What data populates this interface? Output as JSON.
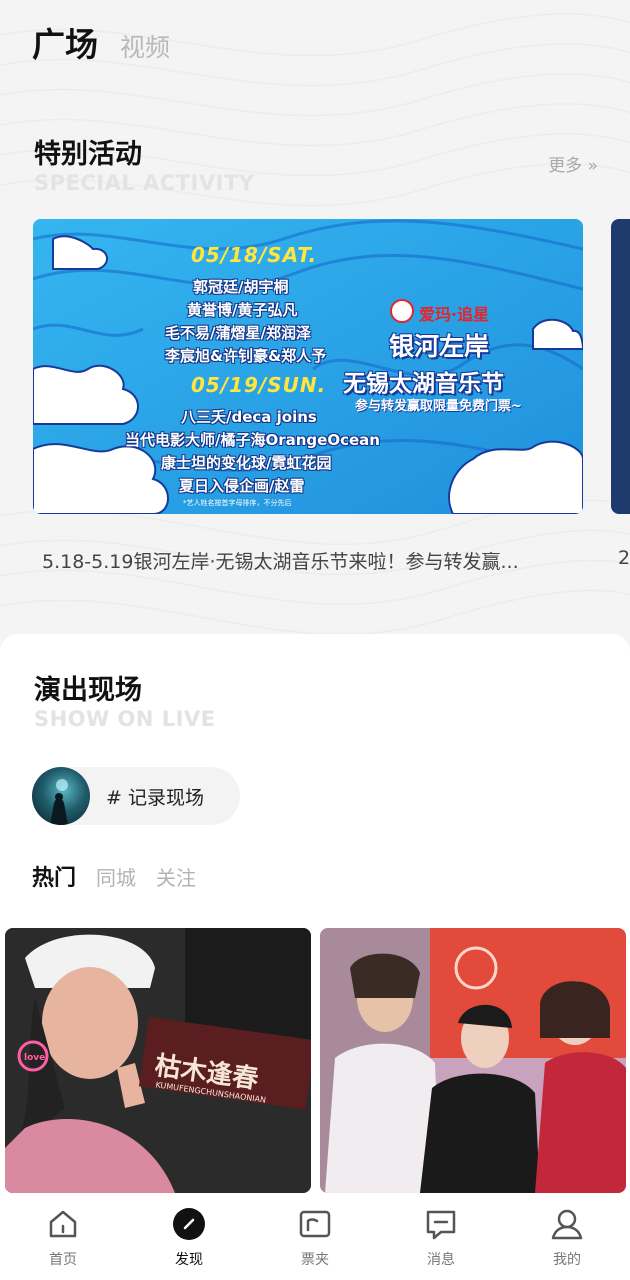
{
  "top_tabs": {
    "active": "广场",
    "inactive": "视频"
  },
  "special": {
    "title": "特别活动",
    "subtitle": "SPECIAL ACTIVITY",
    "more": "更多 »",
    "banner": {
      "date1": "05/18/SAT.",
      "day1": [
        "郭冠廷/胡宇桐",
        "黄誉博/黄子弘凡",
        "毛不易/蒲熠星/郑润泽",
        "李宸旭&许钊豪&郑人予"
      ],
      "date2": "05/19/SUN.",
      "day2": [
        "八三夭/deca joins",
        "当代电影大师/橘子海OrangeOcean",
        "康士坦的变化球/霓虹花园",
        "夏日入侵企画/赵雷"
      ],
      "note": "*艺人姓名按首字母排序，不分先后",
      "brand": "爱玛·追星",
      "title1": "银河左岸",
      "title2": "无锡太湖音乐节",
      "slogan": "参与转发赢取限量免费门票~"
    },
    "caption": "5.18-5.19银河左岸·无锡太湖音乐节来啦！参与转发赢...",
    "caption_next": "2"
  },
  "live": {
    "title": "演出现场",
    "subtitle": "SHOW ON LIVE",
    "topic": "# 记录现场",
    "tabs": [
      "热门",
      "同城",
      "关注"
    ]
  },
  "photo_left_sign": "枯木逢春",
  "photo_left_sign_sub": "KUMUFENGCHUNSHAONIAN",
  "photo_left_badge": "love",
  "nav": [
    {
      "label": "首页",
      "icon": "home-icon"
    },
    {
      "label": "发现",
      "icon": "discover-icon"
    },
    {
      "label": "票夹",
      "icon": "ticket-folder-icon"
    },
    {
      "label": "消息",
      "icon": "message-icon"
    },
    {
      "label": "我的",
      "icon": "profile-icon"
    }
  ],
  "colors": {
    "banner_blue": "#2aa7e8",
    "date_yellow": "#ffe53d",
    "brand_red": "#e5242b"
  }
}
